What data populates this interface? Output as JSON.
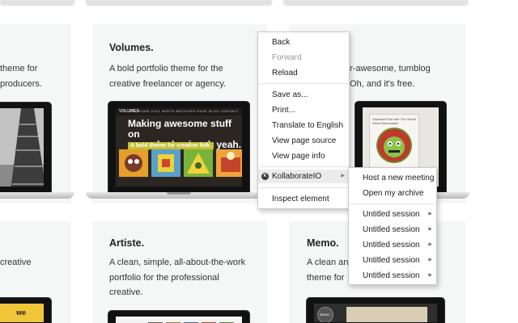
{
  "cards": {
    "left_top": {
      "desc_lines": [
        "theme for",
        "producers."
      ]
    },
    "volumes": {
      "title": "Volumes.",
      "desc_lines": [
        "A bold portfolio theme for the",
        "creative freelancer or agency."
      ],
      "screen": {
        "logo": "VOLUMES",
        "nav": "HOME  FULL WIDTH  ARCHIVES  PAGE  BLOG  CONTACT",
        "headline_lines": [
          "Making awesome stuff on",
          "a regular basis, oh yeah."
        ],
        "subhead": "A bold theme for creative folk."
      }
    },
    "right_top": {
      "desc_lines": [
        "er-awesome, tumblog",
        ". Oh, and it's free."
      ],
      "screen": {
        "caption": "Standard Post with The Whole Show Relocatable"
      }
    },
    "left_bottom": {
      "desc_lines": [
        "creative"
      ],
      "screen": {
        "text": "we"
      }
    },
    "artiste": {
      "title": "Artiste.",
      "desc_lines": [
        "A clean, simple, all-about-the-work",
        "portfolio for the professional",
        "creative."
      ]
    },
    "memo": {
      "title": "Memo.",
      "desc_lines": [
        "A clean an",
        "theme for"
      ],
      "screen": {
        "badge": "MEMO"
      }
    }
  },
  "context_menu": {
    "items": [
      {
        "label": "Back",
        "enabled": true
      },
      {
        "label": "Forward",
        "enabled": false
      },
      {
        "label": "Reload",
        "enabled": true
      },
      {
        "label": "Save as...",
        "enabled": true
      },
      {
        "label": "Print...",
        "enabled": true
      },
      {
        "label": "Translate to English",
        "enabled": true
      },
      {
        "label": "View page source",
        "enabled": true
      },
      {
        "label": "View page info",
        "enabled": true
      },
      {
        "label": "KollaborateIO",
        "enabled": true,
        "icon": "kollaborate-icon",
        "icon_letter": "K",
        "submenu": true
      },
      {
        "label": "Inspect element",
        "enabled": true
      }
    ]
  },
  "submenu": {
    "items": [
      {
        "label": "Host a new meeting"
      },
      {
        "label": "Open my archive"
      },
      {
        "label": "Untitled session",
        "submenu": true
      },
      {
        "label": "Untitled session",
        "submenu": true
      },
      {
        "label": "Untitled session",
        "submenu": true
      },
      {
        "label": "Untitled session",
        "submenu": true
      },
      {
        "label": "Untitled session",
        "submenu": true
      }
    ]
  },
  "colors": {
    "card_bg": "#f5f6f6",
    "menu_highlight": "#ebebeb",
    "volumes_accent": "#c3c035"
  }
}
